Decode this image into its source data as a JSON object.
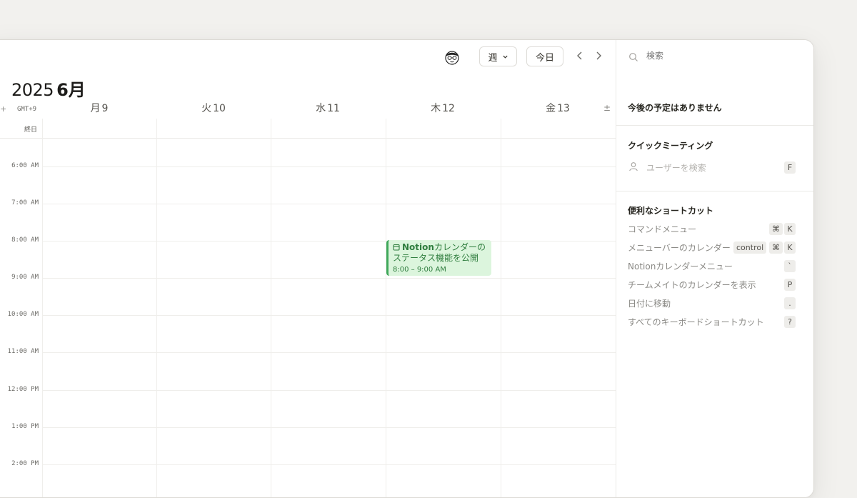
{
  "header": {
    "view_label": "週",
    "today_label": "今日",
    "year": "2025",
    "month": "6月"
  },
  "timezone": {
    "plus": "+",
    "label": "GMT+9"
  },
  "days": [
    {
      "dow": "月",
      "num": "9"
    },
    {
      "dow": "火",
      "num": "10"
    },
    {
      "dow": "水",
      "num": "11"
    },
    {
      "dow": "木",
      "num": "12"
    },
    {
      "dow": "金",
      "num": "13"
    }
  ],
  "collapse_glyph": "±",
  "all_day_label": "終日",
  "times": [
    "6:00 AM",
    "7:00 AM",
    "8:00 AM",
    "9:00 AM",
    "10:00 AM",
    "11:00 AM",
    "12:00 PM",
    "1:00 PM",
    "2:00 PM"
  ],
  "event": {
    "title_bold": "Notion",
    "title_rest": "カレンダーの",
    "title_line2": "ステータス機能を公開",
    "time": "8:00 – 9:00 AM",
    "color": "#3fa85a"
  },
  "sidebar": {
    "search_placeholder": "検索",
    "upcoming": "今後の予定はありません",
    "quick_meeting": "クイックミーティング",
    "user_search": "ユーザーを検索",
    "user_search_key": "F",
    "shortcuts_heading": "便利なショートカット",
    "shortcuts": [
      {
        "label": "コマンドメニュー",
        "keys": [
          "⌘",
          "K"
        ]
      },
      {
        "label": "メニューバーのカレンダー",
        "keys": [
          "control",
          "⌘",
          "K"
        ]
      },
      {
        "label": "Notionカレンダーメニュー",
        "keys": [
          "`"
        ]
      },
      {
        "label": "チームメイトのカレンダーを表示",
        "keys": [
          "P"
        ]
      },
      {
        "label": "日付に移動",
        "keys": [
          "."
        ]
      },
      {
        "label": "すべてのキーボードショートカット",
        "keys": [
          "?"
        ]
      }
    ]
  }
}
